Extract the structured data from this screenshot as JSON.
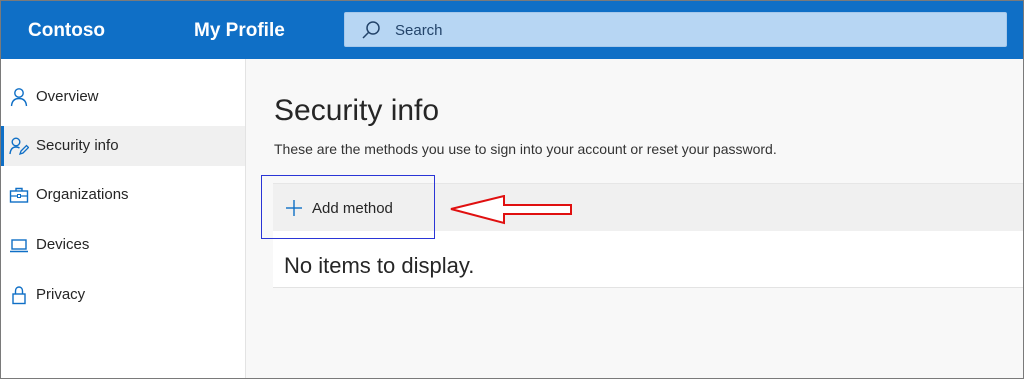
{
  "header": {
    "brand": "Contoso",
    "app_title": "My Profile",
    "search": {
      "placeholder": "Search",
      "icon": "search-icon"
    },
    "background_color": "#0f6fc6"
  },
  "sidebar": {
    "items": [
      {
        "label": "Overview",
        "icon": "person-icon",
        "active": false
      },
      {
        "label": "Security info",
        "icon": "security-info-icon",
        "active": true
      },
      {
        "label": "Organizations",
        "icon": "briefcase-icon",
        "active": false
      },
      {
        "label": "Devices",
        "icon": "laptop-icon",
        "active": false
      },
      {
        "label": "Privacy",
        "icon": "lock-icon",
        "active": false
      }
    ]
  },
  "main": {
    "title": "Security info",
    "description": "These are the methods you use to sign into your account or reset your password.",
    "add_method_label": "Add method",
    "empty_message": "No items to display."
  },
  "annotations": {
    "highlight_color": "#2a35d6",
    "arrow_color": "#e01010"
  }
}
